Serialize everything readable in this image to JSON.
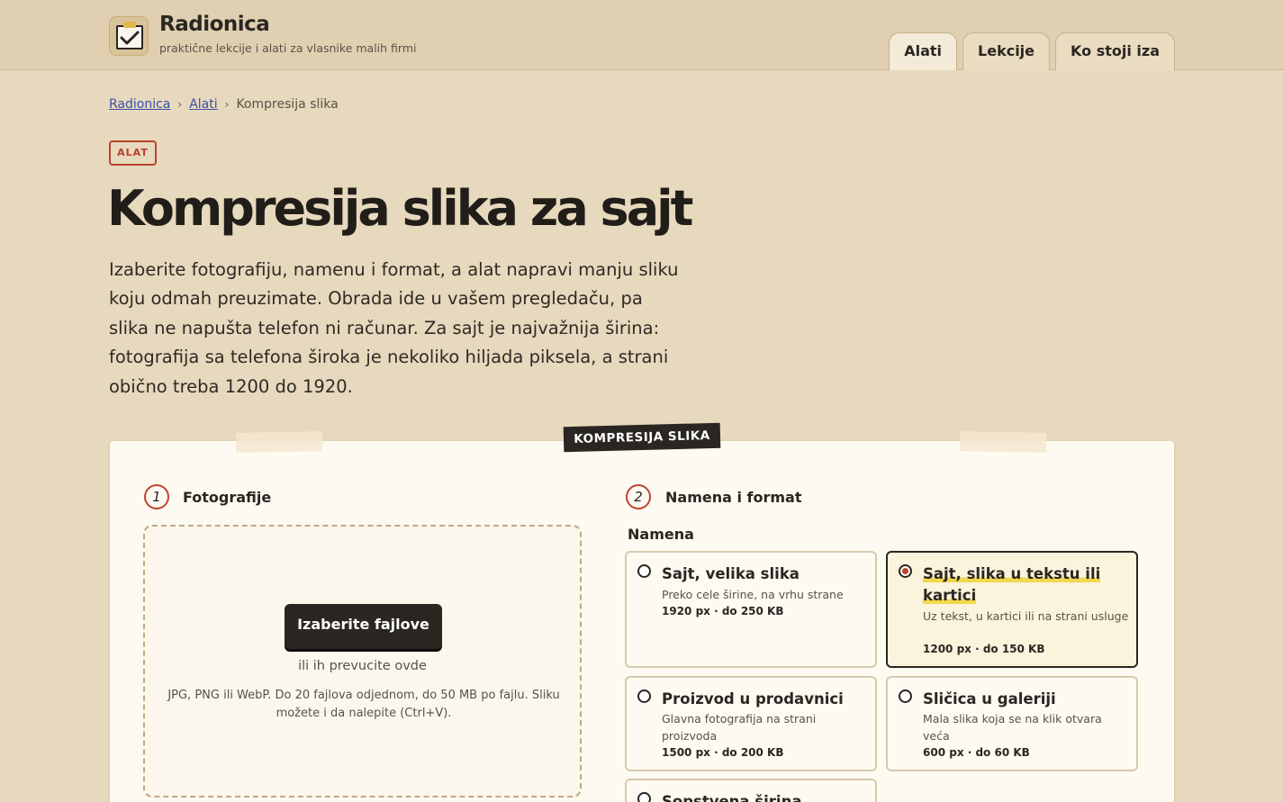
{
  "header": {
    "brand_name": "Radionica",
    "brand_tagline": "praktične lekcije i alati za vlasnike malih firmi",
    "logo_icon": "clipboard-check-icon",
    "nav": [
      {
        "label": "Alati",
        "active": true
      },
      {
        "label": "Lekcije",
        "active": false
      },
      {
        "label": "Ko stoji iza",
        "active": false
      }
    ]
  },
  "breadcrumb": {
    "items": [
      "Radionica",
      "Alati",
      "Kompresija slika"
    ],
    "separator": "›"
  },
  "page": {
    "badge": "ALAT",
    "title": "Kompresija slika za sajt",
    "lead": "Izaberite fotografiju, namenu i format, a alat napravi manju sliku koju odmah preuzimate. Obrada ide u vašem pregledaču, pa slika ne napušta telefon ni računar. Za sajt je najvažnija širina: fotografija sa telefona široka je nekoliko hiljada piksela, a strani obično treba 1200 do 1920."
  },
  "tool": {
    "label": "KOMPRESIJA SLIKA",
    "step1": {
      "num": "1",
      "title": "Fotografije"
    },
    "step2": {
      "num": "2",
      "title": "Namena i format"
    },
    "dropzone": {
      "button": "Izaberite fajlove",
      "hint": "ili ih prevucite ovde",
      "note": "JPG, PNG ili WebP. Do 20 fajlova odjednom, do 50 MB po fajlu. Sliku možete i da nalepite (Ctrl+V)."
    },
    "purpose_label": "Namena",
    "options": [
      {
        "title": "Sajt, velika slika",
        "desc": "Preko cele širine, na vrhu strane",
        "spec": "1920 px · do 250 KB",
        "selected": false
      },
      {
        "title": "Sajt, slika u tekstu ili kartici",
        "desc": "Uz tekst, u kartici ili na strani usluge",
        "spec": "1200 px · do 150 KB",
        "selected": true
      },
      {
        "title": "Proizvod u prodavnici",
        "desc": "Glavna fotografija na strani proizvoda",
        "spec": "1500 px · do 200 KB",
        "selected": false
      },
      {
        "title": "Sličica u galeriji",
        "desc": "Mala slika koja se na klik otvara veća",
        "spec": "600 px · do 60 KB",
        "selected": false
      },
      {
        "title": "Sopstvena širina",
        "desc": "",
        "spec": "",
        "selected": false
      }
    ]
  },
  "colors": {
    "background": "#e7d9bd",
    "card": "#fdfaf1",
    "accent_red": "#c0442f",
    "dark": "#2a2622",
    "link": "#3b4fa8",
    "highlight": "#f1d84f"
  }
}
